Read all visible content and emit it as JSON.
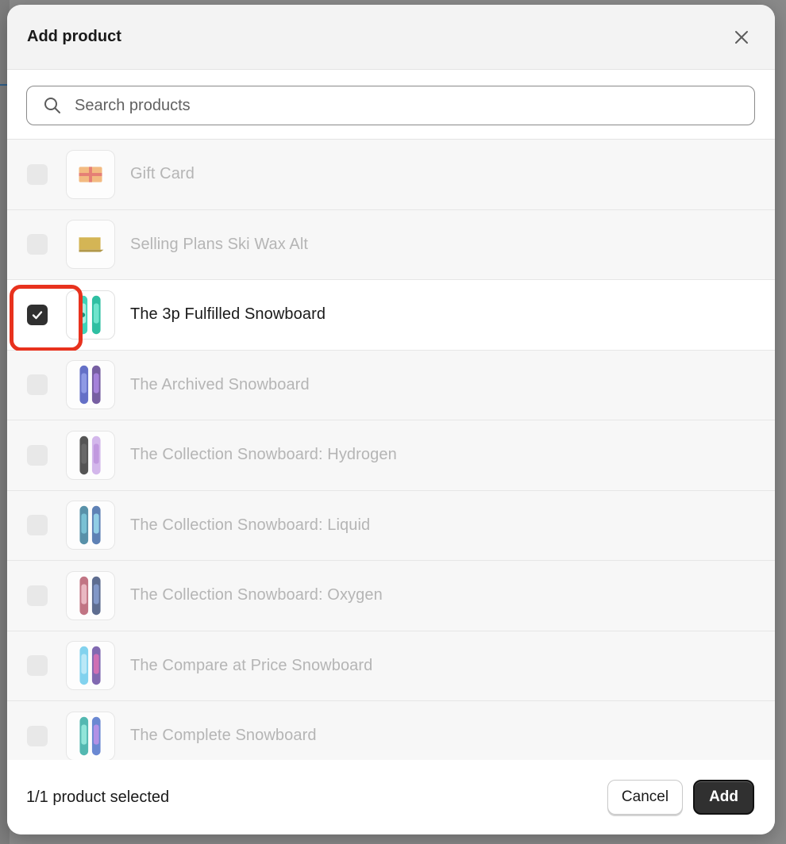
{
  "modal": {
    "title": "Add product",
    "close_icon": "close-icon"
  },
  "search": {
    "placeholder": "Search products",
    "value": "",
    "icon": "search-icon"
  },
  "products": [
    {
      "name": "Gift Card",
      "selected": false,
      "thumb": "gift-card"
    },
    {
      "name": "Selling Plans Ski Wax Alt",
      "selected": false,
      "thumb": "ski-wax"
    },
    {
      "name": "The 3p Fulfilled Snowboard",
      "selected": true,
      "thumb": "snowboard-teal"
    },
    {
      "name": "The Archived Snowboard",
      "selected": false,
      "thumb": "snowboard-blue"
    },
    {
      "name": "The Collection Snowboard: Hydrogen",
      "selected": false,
      "thumb": "snowboard-black-purple"
    },
    {
      "name": "The Collection Snowboard: Liquid",
      "selected": false,
      "thumb": "snowboard-liquid"
    },
    {
      "name": "The Collection Snowboard: Oxygen",
      "selected": false,
      "thumb": "snowboard-oxygen"
    },
    {
      "name": "The Compare at Price Snowboard",
      "selected": false,
      "thumb": "snowboard-compare"
    },
    {
      "name": "The Complete Snowboard",
      "selected": false,
      "thumb": "snowboard-complete"
    }
  ],
  "footer": {
    "selection_count": "1/1 product selected",
    "cancel_label": "Cancel",
    "add_label": "Add"
  },
  "colors": {
    "primary_button": "#303030",
    "highlight": "#e8321e",
    "disabled_text": "#b5b5b5"
  }
}
